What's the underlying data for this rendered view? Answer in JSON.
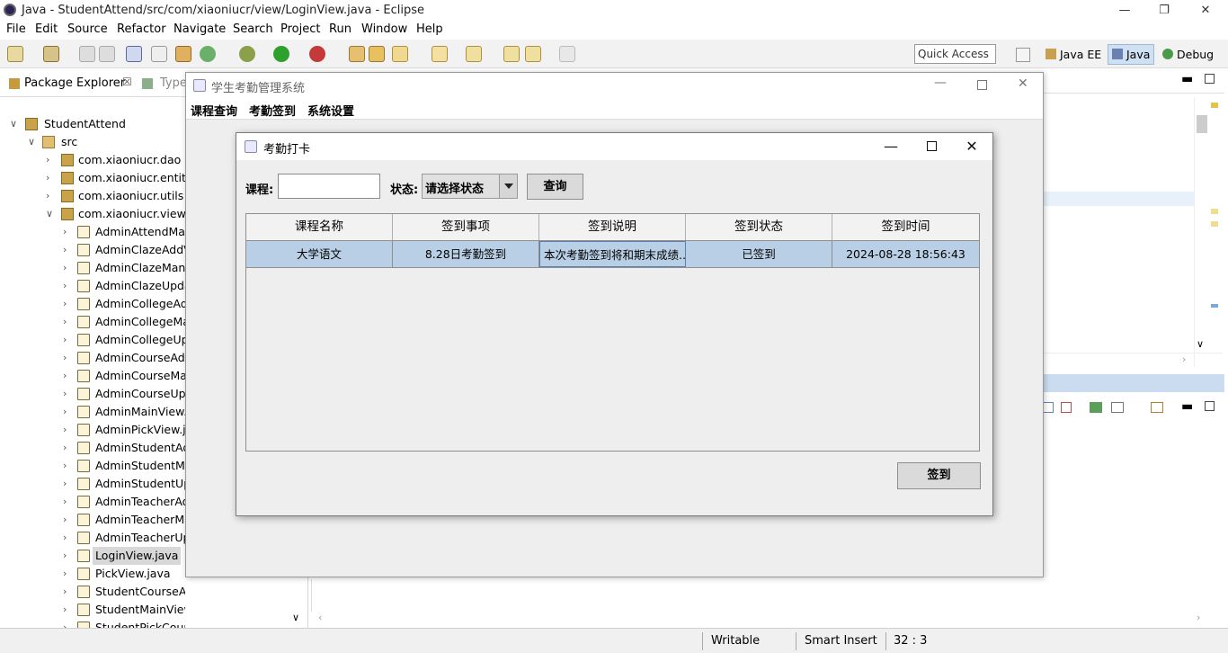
{
  "eclipse": {
    "title": "Java - StudentAttend/src/com/xiaoniucr/view/LoginView.java - Eclipse",
    "menu": [
      "File",
      "Edit",
      "Source",
      "Refactor",
      "Navigate",
      "Search",
      "Project",
      "Run",
      "Window",
      "Help"
    ],
    "quick_access": "Quick Access",
    "perspectives": [
      "Java EE",
      "Java",
      "Debug"
    ],
    "explorer_tab": "Package Explorer",
    "explorer_tab2": "Type",
    "tree": {
      "project": "StudentAttend",
      "src": "src",
      "packages": [
        "com.xiaoniucr.dao",
        "com.xiaoniucr.entity",
        "com.xiaoniucr.utils",
        "com.xiaoniucr.view"
      ],
      "files": [
        "AdminAttendMan",
        "AdminClazeAddV",
        "AdminClazeMana",
        "AdminClazeUpda",
        "AdminCollegeAdd",
        "AdminCollegeMa",
        "AdminCollegeUpd",
        "AdminCourseAdd",
        "AdminCourseMan",
        "AdminCourseUpd",
        "AdminMainView.j",
        "AdminPickView.ja",
        "AdminStudentAdd",
        "AdminStudentMa",
        "AdminStudentUpd",
        "AdminTeacherAd",
        "AdminTeacherMa",
        "AdminTeacherUp",
        "LoginView.java",
        "PickView.java",
        "StudentCourseAllView.java",
        "StudentMainView.java",
        "StudentPickCourseView.java"
      ]
    },
    "status": {
      "writable": "Writable",
      "insert": "Smart Insert",
      "position": "32 : 3"
    }
  },
  "app": {
    "title": "学生考勤管理系统",
    "menu": [
      "课程查询",
      "考勤签到",
      "系统设置"
    ]
  },
  "dialog": {
    "title": "考勤打卡",
    "course_label": "课程:",
    "state_label": "状态:",
    "state_value": "请选择状态",
    "query_label": "查询",
    "columns": [
      "课程名称",
      "签到事项",
      "签到说明",
      "签到状态",
      "签到时间"
    ],
    "rows": [
      [
        "大学语文",
        "8.28日考勤签到",
        "本次考勤签到将和期末成绩...",
        "已签到",
        "2024-08-28 18:56:43"
      ]
    ],
    "sign_label": "签到"
  }
}
